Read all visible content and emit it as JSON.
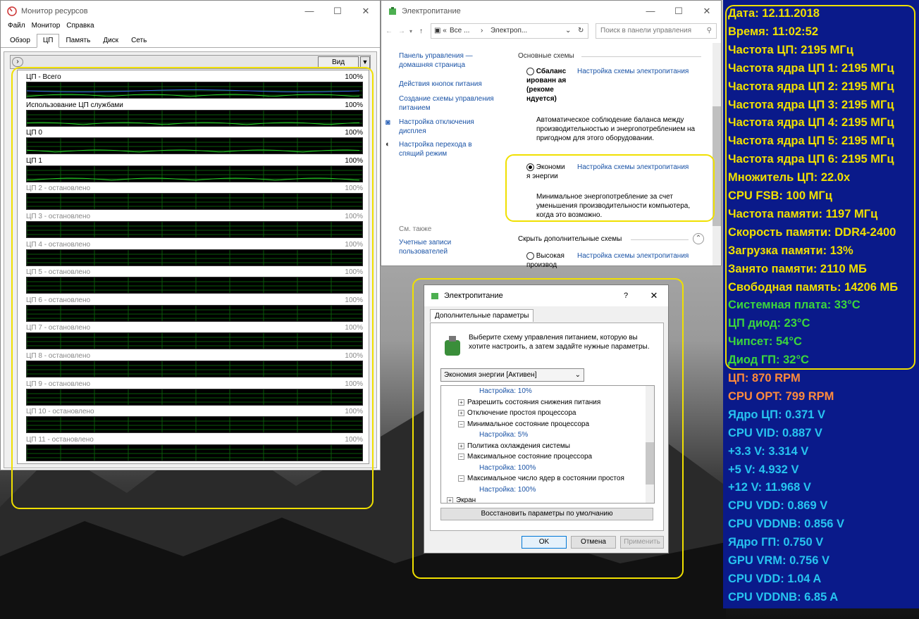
{
  "resmon": {
    "title": "Монитор ресурсов",
    "menu": [
      "Файл",
      "Монитор",
      "Справка"
    ],
    "tabs": [
      "Обзор",
      "ЦП",
      "Память",
      "Диск",
      "Сеть"
    ],
    "view_button": "Вид",
    "graphs": [
      {
        "label": "ЦП - Всего",
        "max": "100%",
        "stopped": false
      },
      {
        "label": "Использование ЦП службами",
        "max": "100%",
        "stopped": false
      },
      {
        "label": "ЦП 0",
        "max": "100%",
        "stopped": false
      },
      {
        "label": "ЦП 1",
        "max": "100%",
        "stopped": false
      },
      {
        "label": "ЦП 2 - остановлено",
        "max": "100%",
        "stopped": true
      },
      {
        "label": "ЦП 3 - остановлено",
        "max": "100%",
        "stopped": true
      },
      {
        "label": "ЦП 4 - остановлено",
        "max": "100%",
        "stopped": true
      },
      {
        "label": "ЦП 5 - остановлено",
        "max": "100%",
        "stopped": true
      },
      {
        "label": "ЦП 6 - остановлено",
        "max": "100%",
        "stopped": true
      },
      {
        "label": "ЦП 7 - остановлено",
        "max": "100%",
        "stopped": true
      },
      {
        "label": "ЦП 8 - остановлено",
        "max": "100%",
        "stopped": true
      },
      {
        "label": "ЦП 9 - остановлено",
        "max": "100%",
        "stopped": true
      },
      {
        "label": "ЦП 10 - остановлено",
        "max": "100%",
        "stopped": true
      },
      {
        "label": "ЦП 11 - остановлено",
        "max": "100%",
        "stopped": true
      }
    ]
  },
  "power": {
    "title": "Электропитание",
    "breadcrumb": [
      "Все ...",
      "Электроп..."
    ],
    "search_placeholder": "Поиск в панели управления",
    "left_links": [
      "Панель управления — домашняя страница",
      "Действия кнопок питания",
      "Создание схемы управления питанием",
      "Настройка отключения дисплея",
      "Настройка перехода в спящий режим"
    ],
    "see_also": "См. также",
    "accounts_link": "Учетные записи пользователей",
    "basic_schemes": "Основные схемы",
    "balanced_name": "Сбаланс ированн ая (рекоме ндуется)",
    "balanced_desc": "Автоматическое соблюдение баланса между производительностью и энергопотреблением на пригодном для этого оборудовании.",
    "scheme_link": "Настройка схемы электропитания",
    "economy_name": "Экономи я энергии",
    "economy_desc": "Минимальное энергопотребление за счет уменьшения производительности компьютера, когда это возможно.",
    "hide_extra": "Скрыть дополнительные схемы",
    "high_name": "Высокая производ"
  },
  "dialog": {
    "title": "Электропитание",
    "help": "?",
    "tab": "Дополнительные параметры",
    "intro": "Выберите схему управления питанием, которую вы хотите настроить, а затем задайте нужные параметры.",
    "selected_plan": "Экономия энергии [Активен]",
    "tree": [
      {
        "text": "Настройка: 10%",
        "kind": "value"
      },
      {
        "text": "Разрешить состояния снижения питания",
        "kind": "plus"
      },
      {
        "text": "Отключение простоя процессора",
        "kind": "plus"
      },
      {
        "text": "Минимальное состояние процессора",
        "kind": "minus"
      },
      {
        "text": "Настройка: 5%",
        "kind": "value"
      },
      {
        "text": "Политика охлаждения системы",
        "kind": "plus"
      },
      {
        "text": "Максимальное состояние процессора",
        "kind": "minus"
      },
      {
        "text": "Настройка: 100%",
        "kind": "value"
      },
      {
        "text": "Максимальное число ядер в состоянии простоя",
        "kind": "minus"
      },
      {
        "text": "Настройка: 100%",
        "kind": "value"
      },
      {
        "text": "Экран",
        "kind": "plus-top"
      }
    ],
    "restore_button": "Восстановить параметры по умолчанию",
    "ok": "OK",
    "cancel": "Отмена",
    "apply": "Применить"
  },
  "sensors": [
    {
      "text": "Дата: 12.11.2018",
      "color": "#f0e000"
    },
    {
      "text": "Время: 11:02:52",
      "color": "#f0e000"
    },
    {
      "text": "Частота ЦП: 2195 МГц",
      "color": "#f0e000"
    },
    {
      "text": "Частота ядра ЦП 1: 2195 МГц",
      "color": "#f0e000"
    },
    {
      "text": "Частота ядра ЦП 2: 2195 МГц",
      "color": "#f0e000"
    },
    {
      "text": "Частота ядра ЦП 3: 2195 МГц",
      "color": "#f0e000"
    },
    {
      "text": "Частота ядра ЦП 4: 2195 МГц",
      "color": "#f0e000"
    },
    {
      "text": "Частота ядра ЦП 5: 2195 МГц",
      "color": "#f0e000"
    },
    {
      "text": "Частота ядра ЦП 6: 2195 МГц",
      "color": "#f0e000"
    },
    {
      "text": "Множитель ЦП: 22.0x",
      "color": "#f0e000"
    },
    {
      "text": "CPU FSB: 100 МГц",
      "color": "#f0e000"
    },
    {
      "text": "Частота памяти: 1197 МГц",
      "color": "#f0e000"
    },
    {
      "text": "Скорость памяти: DDR4-2400",
      "color": "#f0e000"
    },
    {
      "text": "Загрузка памяти: 13%",
      "color": "#f0e000"
    },
    {
      "text": "Занято памяти: 2110 МБ",
      "color": "#f0e000"
    },
    {
      "text": "Свободная память: 14206 МБ",
      "color": "#f0e000"
    },
    {
      "text": "Системная плата: 33°C",
      "color": "#3cd63c"
    },
    {
      "text": "ЦП диод: 23°C",
      "color": "#3cd63c"
    },
    {
      "text": "Чипсет: 54°C",
      "color": "#3cd63c"
    },
    {
      "text": "Диод ГП: 32°C",
      "color": "#3cd63c"
    },
    {
      "text": "ЦП: 870 RPM",
      "color": "#ff8a3c"
    },
    {
      "text": "CPU OPT: 799 RPM",
      "color": "#ff8a3c"
    },
    {
      "text": "Ядро ЦП: 0.371 V",
      "color": "#27c4f0"
    },
    {
      "text": "CPU VID: 0.887 V",
      "color": "#27c4f0"
    },
    {
      "text": "+3.3 V: 3.314 V",
      "color": "#27c4f0"
    },
    {
      "text": "+5 V: 4.932 V",
      "color": "#27c4f0"
    },
    {
      "text": "+12 V: 11.968 V",
      "color": "#27c4f0"
    },
    {
      "text": "CPU VDD: 0.869 V",
      "color": "#27c4f0"
    },
    {
      "text": "CPU VDDNB: 0.856 V",
      "color": "#27c4f0"
    },
    {
      "text": "Ядро ГП: 0.750 V",
      "color": "#27c4f0"
    },
    {
      "text": "GPU VRM: 0.756 V",
      "color": "#27c4f0"
    },
    {
      "text": "CPU VDD: 1.04 A",
      "color": "#27c4f0"
    },
    {
      "text": "CPU VDDNB: 6.85 A",
      "color": "#27c4f0"
    }
  ]
}
